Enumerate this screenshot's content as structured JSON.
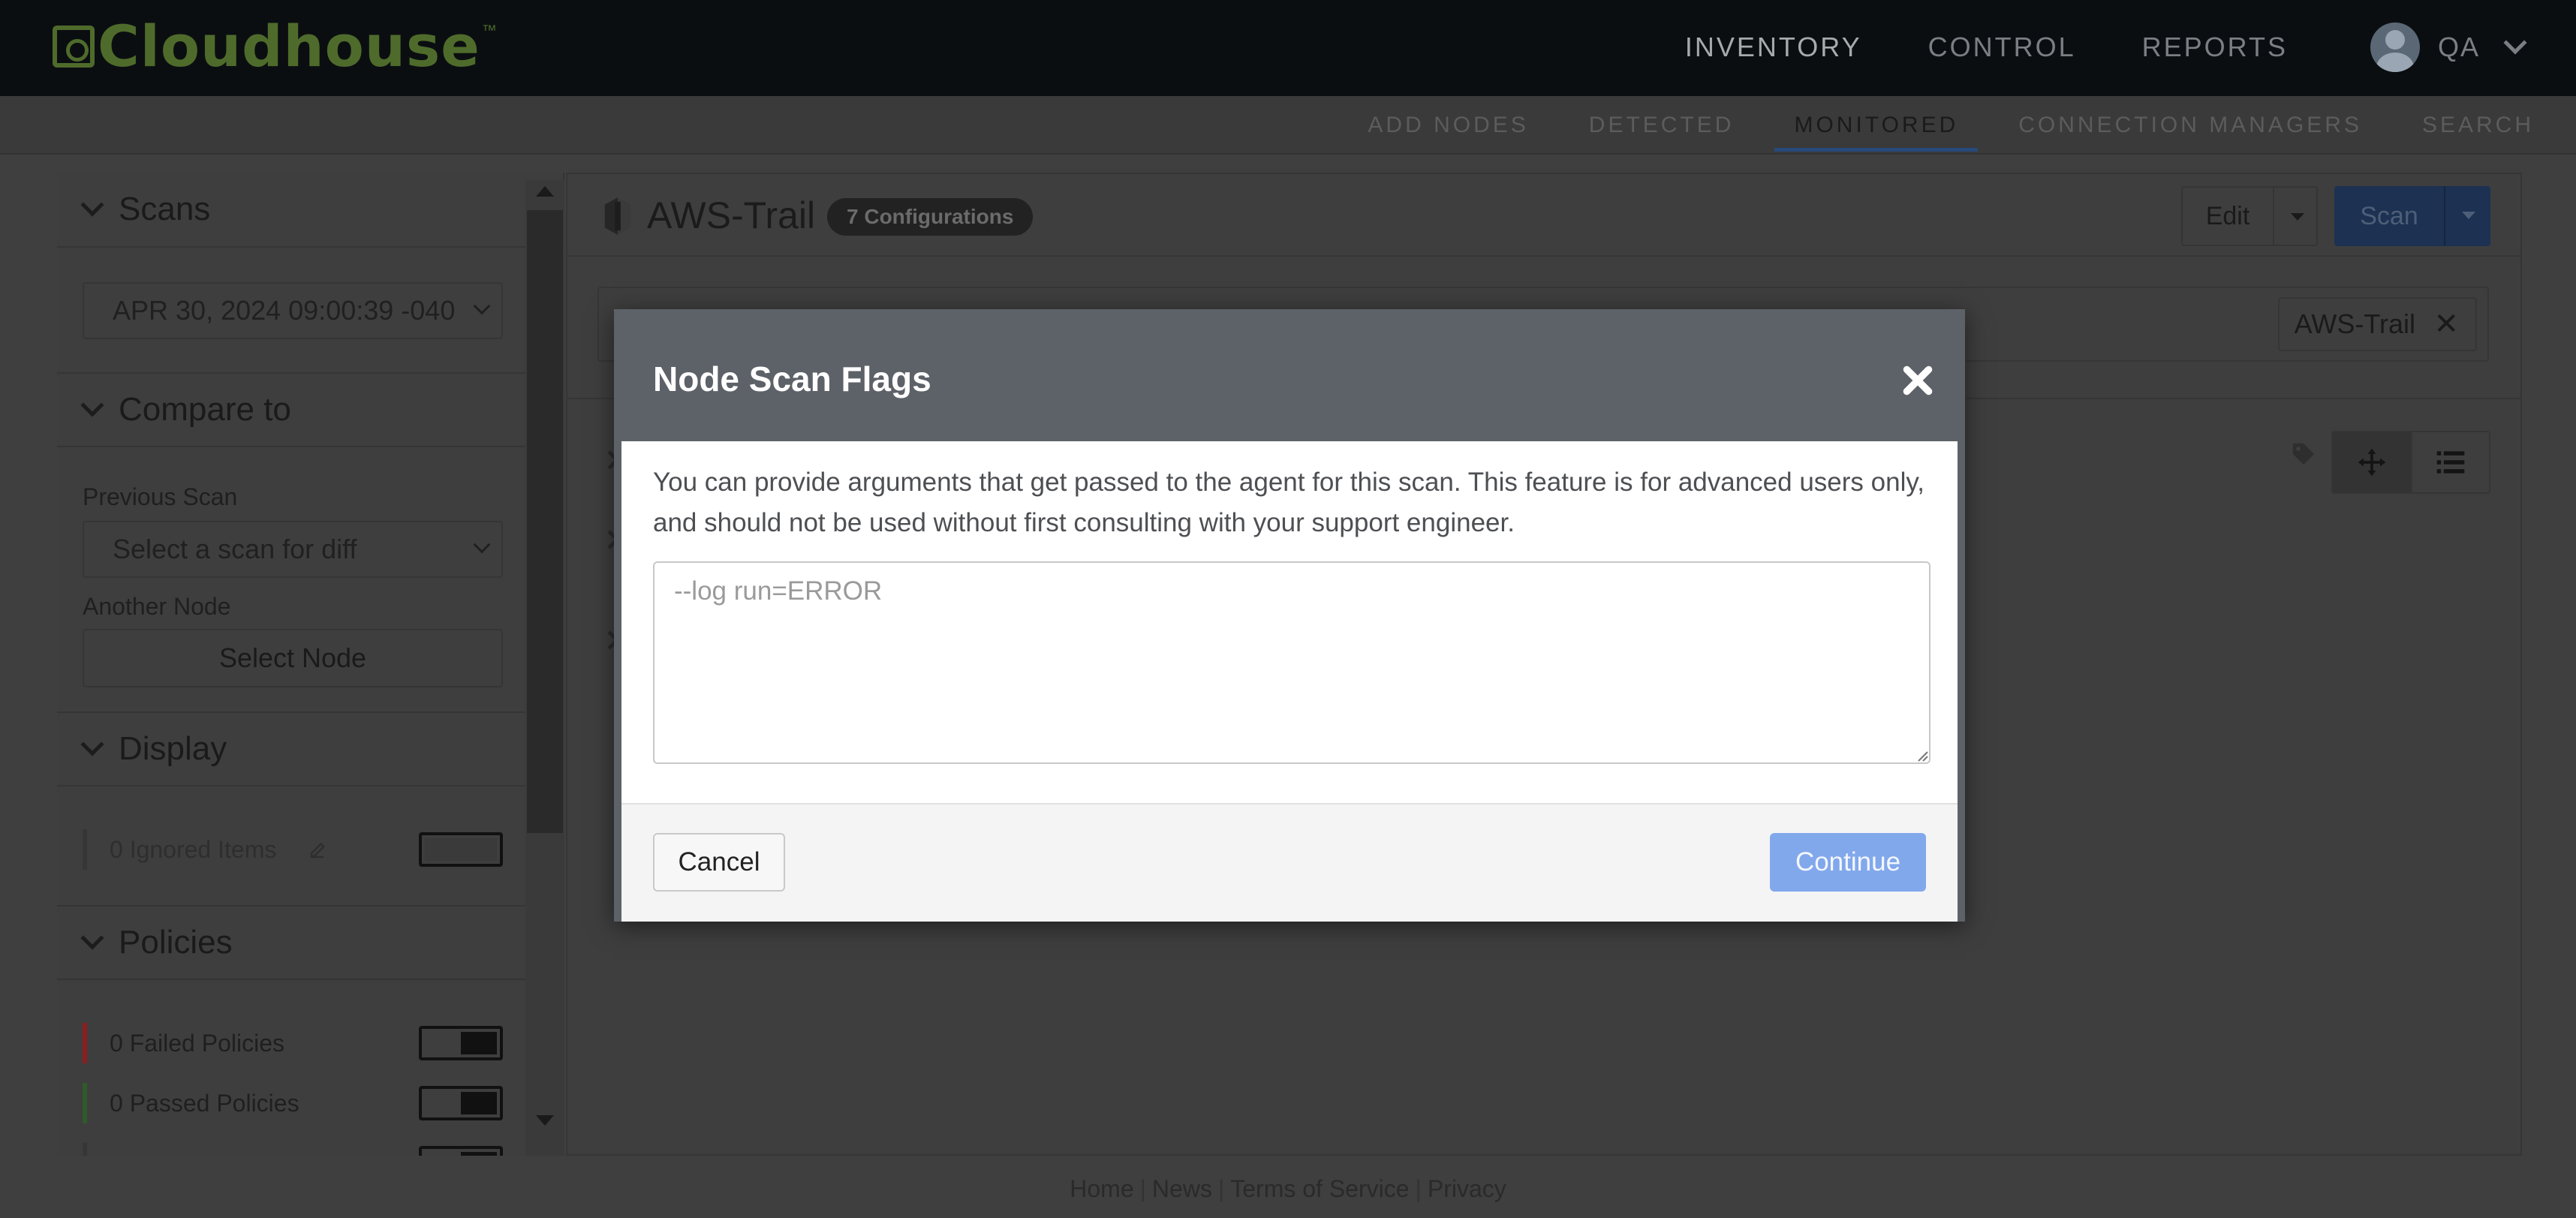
{
  "header": {
    "logo_text": "Cloudhouse",
    "logo_tm": "™",
    "nav": [
      "INVENTORY",
      "CONTROL",
      "REPORTS"
    ],
    "user": "QA"
  },
  "subnav": {
    "items": [
      "ADD NODES",
      "DETECTED",
      "MONITORED",
      "CONNECTION MANAGERS",
      "SEARCH"
    ],
    "active": "MONITORED"
  },
  "sidebar": {
    "scans": {
      "title": "Scans",
      "selected_scan": "APR 30, 2024 09:00:39 -040"
    },
    "compare": {
      "title": "Compare to",
      "previous_scan_label": "Previous Scan",
      "previous_scan_value": "Select a scan for diff",
      "another_node_label": "Another Node",
      "select_node_button": "Select Node"
    },
    "display": {
      "title": "Display",
      "ignored_items": "0 Ignored Items"
    },
    "policies": {
      "title": "Policies",
      "items": [
        {
          "label": "0 Failed Policies",
          "color": "#8a1f1f"
        },
        {
          "label": "0 Passed Policies",
          "color": "#2f5a2a"
        }
      ]
    }
  },
  "main": {
    "node_title": "AWS-Trail",
    "config_badge": "7 Configurations",
    "edit_label": "Edit",
    "scan_label": "Scan",
    "filter_chip": "AWS-Trail",
    "filter_chip_close": "✕"
  },
  "modal": {
    "title": "Node Scan Flags",
    "close": "✖",
    "description": "You can provide arguments that get passed to the agent for this scan. This feature is for advanced users only, and should not be used without first consulting with your support engineer.",
    "textarea_placeholder": "--log run=ERROR",
    "cancel_label": "Cancel",
    "continue_label": "Continue"
  },
  "footer": {
    "links": [
      "Home",
      "News",
      "Terms of Service",
      "Privacy"
    ]
  },
  "colors": {
    "topbar": "#0b0e11",
    "logo_green": "#4e6b2b",
    "overlay_bg": "#3e3e3e",
    "modal_header": "#5d6268",
    "continue_button": "#82a8ec",
    "scan_button": "#1d3152"
  }
}
